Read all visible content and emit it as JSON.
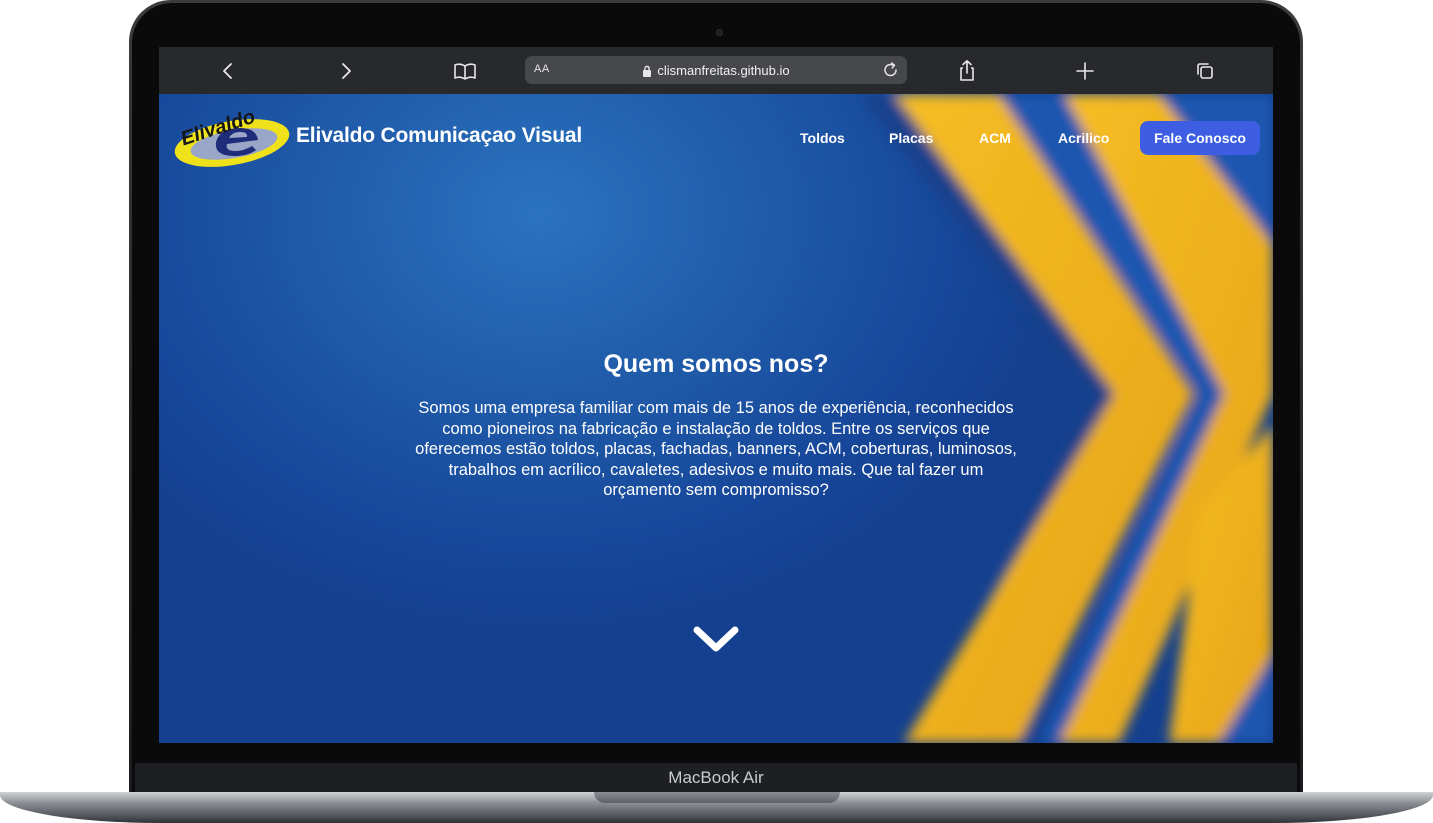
{
  "device": {
    "label": "MacBook Air"
  },
  "browser": {
    "text_size_label": "AA",
    "url": "clismanfreitas.github.io",
    "icons": [
      "back-icon",
      "forward-icon",
      "bookmarks-icon",
      "lock-icon",
      "reload-icon",
      "share-icon",
      "new-tab-icon",
      "tabs-icon"
    ]
  },
  "site": {
    "logo_text": "Elivaldo",
    "brand_name": "Elivaldo Comunicaçao Visual",
    "nav": {
      "items": [
        "Toldos",
        "Placas",
        "ACM",
        "Acrilico"
      ],
      "cta": "Fale Conosco"
    },
    "hero": {
      "title": "Quem somos nos?",
      "text": "Somos uma empresa familiar com mais de 15 anos de experiência, reconhecidos como pioneiros na fabricação e instalação de toldos. Entre os serviços que oferecemos estão toldos, placas, fachadas, banners, ACM, coberturas, luminosos, trabalhos em acrílico, cavaletes, adesivos e muito mais. Que tal fazer um orçamento sem compromisso?"
    },
    "colors": {
      "background_blue": "#1c4e9f",
      "accent_yellow": "#f2b31c",
      "cta_blue": "#3d5ee3",
      "text": "#ffffff"
    }
  }
}
